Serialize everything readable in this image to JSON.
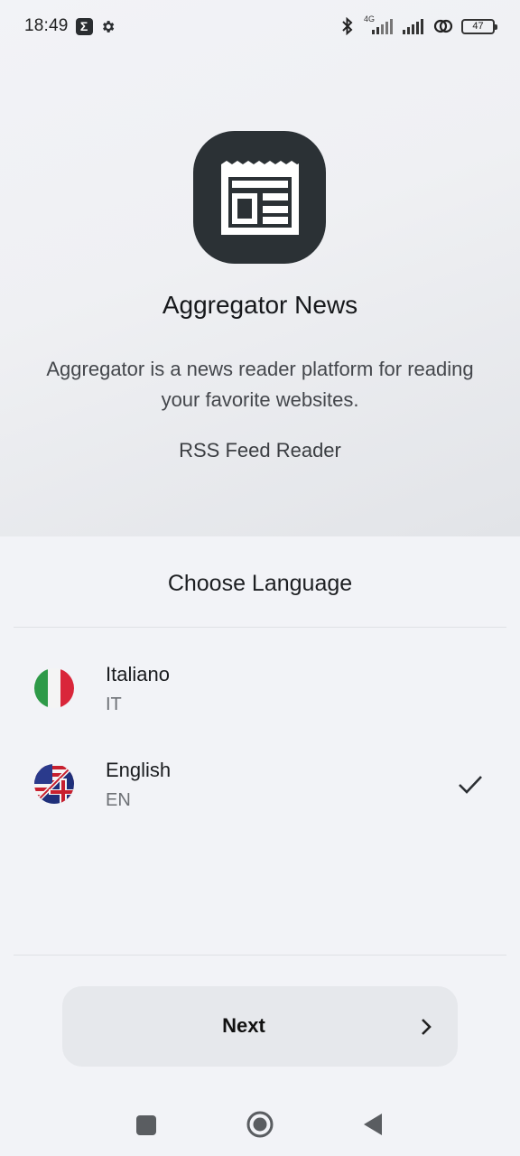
{
  "status_bar": {
    "time": "18:49",
    "sigma": "Σ",
    "network": "4G",
    "battery": "47"
  },
  "app": {
    "title": "Aggregator News",
    "description": "Aggregator is a news reader platform for reading your favorite websites.",
    "subtitle": "RSS Feed Reader"
  },
  "language": {
    "title": "Choose Language",
    "items": [
      {
        "name": "Italiano",
        "code": "IT",
        "selected": false
      },
      {
        "name": "English",
        "code": "EN",
        "selected": true
      }
    ]
  },
  "next_button": {
    "label": "Next"
  },
  "colors": {
    "background": "#f2f3f7",
    "icon_bg": "#2b3135",
    "button_bg": "#e6e8ec"
  }
}
